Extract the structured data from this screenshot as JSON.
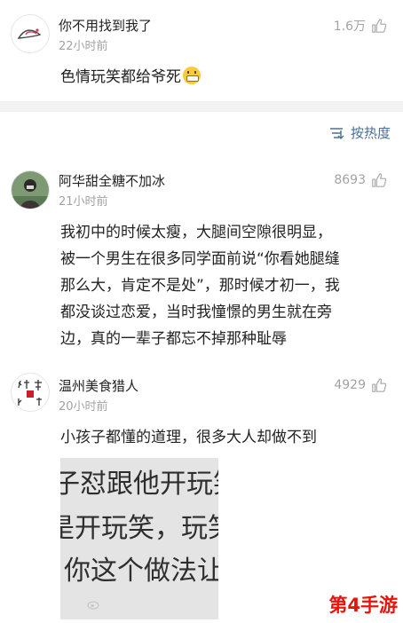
{
  "comments": [
    {
      "username": "你不用找到我了",
      "time": "22小时前",
      "likes": "1.6万",
      "lines": [
        "色情玩笑都给爷死"
      ]
    },
    {
      "username": "阿华甜全糖不加冰",
      "time": "21小时前",
      "likes": "8693",
      "lines": [
        "我初中的时候太瘦，大腿间空隙很明显，",
        "被一个男生在很多同学面前说“你看她腿缝",
        "那么大，肯定不是处”，那时候才初一，我",
        "都没谈过恋爱，当时我憧憬的男生就在旁",
        "边，真的一辈子都忘不掉那种耻辱"
      ]
    },
    {
      "username": "温州美食猎人",
      "time": "20小时前",
      "likes": "4929",
      "lines": [
        "小孩子都懂的道理，很多大人却做不到"
      ],
      "image_lines": [
        "子怼跟他开玩笑",
        "是开玩笑，玩笑",
        "你这个做法让"
      ]
    }
  ],
  "sort": {
    "label": "按热度"
  },
  "watermark_logo": "第4手游"
}
